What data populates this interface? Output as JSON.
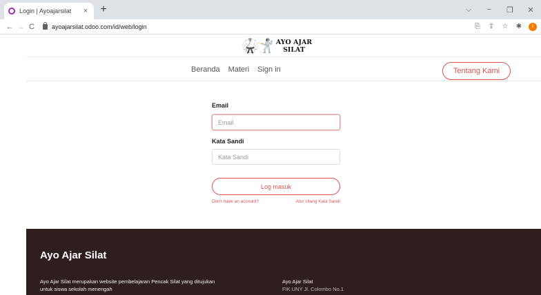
{
  "browser": {
    "tab_title": "Login | Ayoajarsilat",
    "tab_close": "×",
    "new_tab": "+",
    "url": "ayoajarsilat.odoo.com/id/web/login",
    "profile_initial": "!",
    "window_controls": [
      "⌵",
      "−",
      "❐",
      "✕"
    ]
  },
  "site": {
    "logo_line1": "AYO AJAR",
    "logo_line2": "SILAT",
    "logo_figures": "🥋🤺",
    "menu": [
      "Beranda",
      "Materi",
      "Sign in"
    ],
    "about_button": "Tentang Kami",
    "accent_color": "#d9534f"
  },
  "login": {
    "email_label": "Email",
    "email_placeholder": "Email",
    "password_label": "Kata Sandi",
    "password_placeholder": "Kata Sandi",
    "submit_label": "Log masuk",
    "signup_link": "Don't have an account?",
    "reset_link": "Atur Ulang Kata Sandi"
  },
  "footer": {
    "bg_color": "#2f1e1e",
    "title": "Ayo Ajar Silat",
    "description": "Ayo Ajar Silat merupakan website pembelajaran Pencak Silat yang ditujukan untuk siswa sekolah menengah",
    "col2_title": "Ayo Ajar Silat",
    "col2_address": "FIK UNY Jl. Colombo No.1"
  }
}
